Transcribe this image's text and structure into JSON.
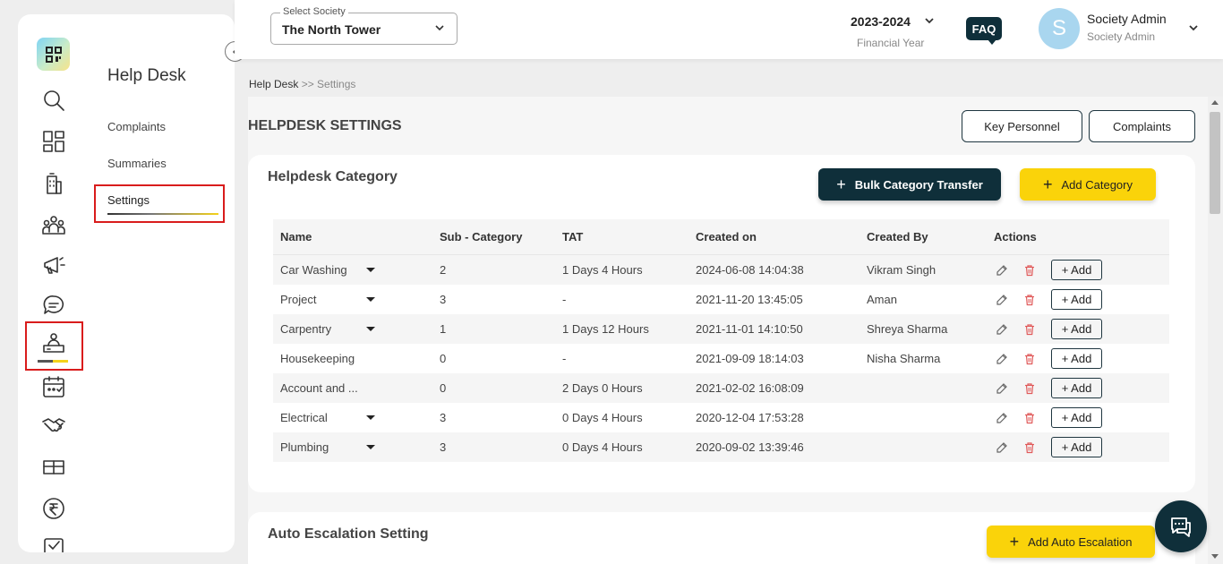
{
  "sidebar": {
    "title": "Help Desk",
    "items": [
      {
        "label": "Complaints"
      },
      {
        "label": "Summaries"
      },
      {
        "label": "Settings",
        "active": true
      }
    ],
    "rail_icons": [
      "search-icon",
      "dashboard-icon",
      "building-icon",
      "community-icon",
      "announcement-icon",
      "chat-icon",
      "helpdesk-icon",
      "calendar-icon",
      "handshake-icon",
      "amenities-icon",
      "rupee-icon",
      "checkbox-icon"
    ]
  },
  "header": {
    "society_label": "Select Society",
    "society_value": "The North Tower",
    "financial_year": "2023-2024",
    "financial_year_label": "Financial Year",
    "faq": "FAQ",
    "avatar_letter": "S",
    "user_name": "Society Admin",
    "user_role": "Society Admin"
  },
  "breadcrumb": {
    "link": "Help Desk",
    "separator": " >> ",
    "current": "Settings"
  },
  "page": {
    "title": "HELPDESK SETTINGS",
    "key_personnel": "Key Personnel",
    "complaints": "Complaints"
  },
  "category_card": {
    "title": "Helpdesk Category",
    "bulk_transfer": "Bulk Category Transfer",
    "add_category": "Add Category",
    "columns": [
      "Name",
      "Sub - Category",
      "TAT",
      "Created on",
      "Created By",
      "Actions"
    ],
    "rows": [
      {
        "name": "Car Washing",
        "sub": "2",
        "tat": "1 Days 4 Hours",
        "created": "2024-06-08 14:04:38",
        "by": "Vikram Singh",
        "expandable": true
      },
      {
        "name": "Project",
        "sub": "3",
        "tat": "-",
        "created": "2021-11-20 13:45:05",
        "by": "Aman",
        "expandable": true
      },
      {
        "name": "Carpentry",
        "sub": "1",
        "tat": "1 Days 12 Hours",
        "created": "2021-11-01 14:10:50",
        "by": "Shreya Sharma",
        "expandable": true
      },
      {
        "name": "Housekeeping",
        "sub": "0",
        "tat": "-",
        "created": "2021-09-09 18:14:03",
        "by": "Nisha Sharma",
        "expandable": false
      },
      {
        "name": "Account and ...",
        "sub": "0",
        "tat": "2 Days 0 Hours",
        "created": "2021-02-02 16:08:09",
        "by": "",
        "expandable": false
      },
      {
        "name": "Electrical",
        "sub": "3",
        "tat": "0 Days 4 Hours",
        "created": "2020-12-04 17:53:28",
        "by": "",
        "expandable": true
      },
      {
        "name": "Plumbing",
        "sub": "3",
        "tat": "0 Days 4 Hours",
        "created": "2020-09-02 13:39:46",
        "by": "",
        "expandable": true
      }
    ],
    "add_label": "+ Add"
  },
  "escalation_card": {
    "title": "Auto Escalation Setting",
    "add_label": "Add Auto Escalation"
  },
  "colors": {
    "accent_dark": "#0f2f3a",
    "accent_yellow": "#fad30a",
    "highlight_red": "#d91c1c"
  }
}
